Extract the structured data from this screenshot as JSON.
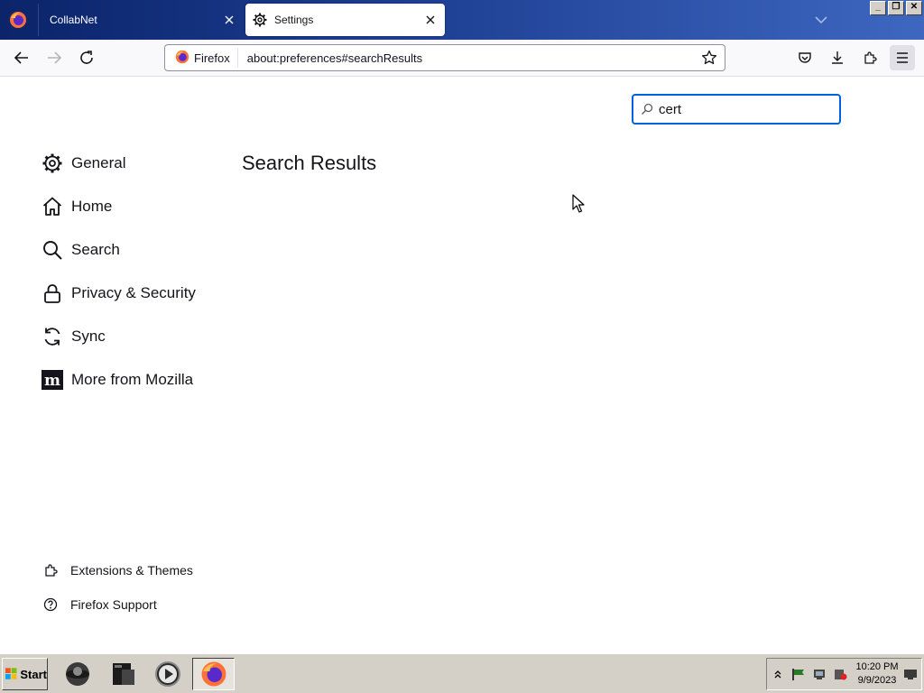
{
  "window": {
    "tabs": [
      {
        "label": "CollabNet",
        "active": false,
        "icon": "firefox-icon"
      },
      {
        "label": "Settings",
        "active": true,
        "icon": "gear-icon"
      }
    ],
    "close_glyph": "✕",
    "window_buttons": {
      "minimize": "_",
      "restore": "❐",
      "close": "✕"
    }
  },
  "navbar": {
    "identity_label": "Firefox",
    "url": "about:preferences#searchResults"
  },
  "search": {
    "value": "cert",
    "icon": "search-icon"
  },
  "main": {
    "title": "Search Results"
  },
  "sidebar": {
    "categories": [
      {
        "label": "General",
        "icon": "gear-icon"
      },
      {
        "label": "Home",
        "icon": "home-icon"
      },
      {
        "label": "Search",
        "icon": "search-icon"
      },
      {
        "label": "Privacy & Security",
        "icon": "lock-icon"
      },
      {
        "label": "Sync",
        "icon": "sync-icon"
      },
      {
        "label": "More from Mozilla",
        "icon": "mozilla-icon"
      }
    ],
    "footer": [
      {
        "label": "Extensions & Themes",
        "icon": "puzzle-icon"
      },
      {
        "label": "Firefox Support",
        "icon": "help-icon"
      }
    ]
  },
  "taskbar": {
    "start_label": "Start",
    "apps": [
      "steam-icon",
      "terminal-icon",
      "media-player-icon",
      "firefox-icon"
    ],
    "clock_time": "10:20 PM",
    "clock_date": "9/9/2023"
  },
  "colors": {
    "accent": "#0061e0",
    "titlebar": "#0b246a",
    "taskbar": "#d4d0c8"
  }
}
